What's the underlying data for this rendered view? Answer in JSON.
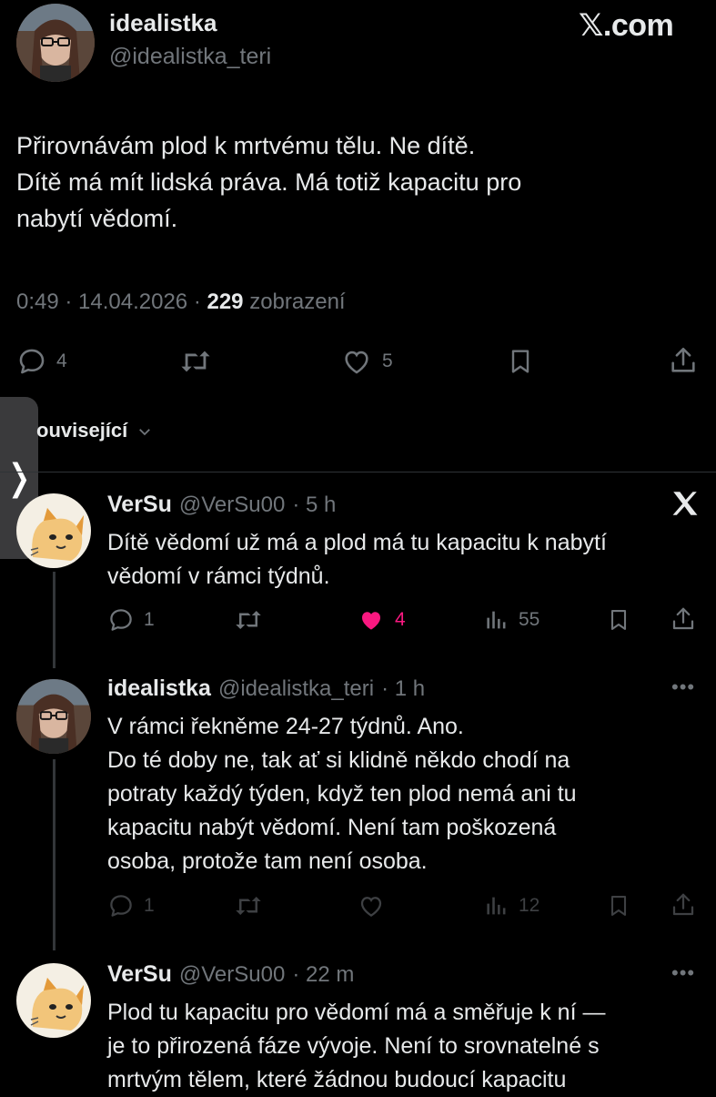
{
  "main_tweet": {
    "display_name": "idealistka",
    "handle": "@idealistka_teri",
    "brand": "𝕏.com",
    "text_lines": [
      "Přirovnávám plod k mrtvému tělu. Ne dítě.",
      "Dítě má mít lidská práva. Má totiž kapacitu pro",
      "nabytí vědomí."
    ],
    "time": "0:49 · 14.04.2026 · ",
    "views_count": "229",
    "views_label": " zobrazení",
    "reply_count": "4",
    "like_count": "5"
  },
  "related_label": "ouvisející",
  "replies": [
    {
      "display_name": "VerSu",
      "handle": "@VerSu00",
      "time": "· 5 h",
      "text_lines": [
        "Dítě vědomí už má a plod má tu kapacitu k nabytí",
        "vědomí v rámci týdnů."
      ],
      "reply_count": "1",
      "like_count": "4",
      "view_count": "55"
    },
    {
      "display_name": "idealistka",
      "handle": "@idealistka_teri",
      "time": "· 1 h",
      "text_lines": [
        "V rámci řekněme 24-27 týdnů. Ano.",
        "Do té doby ne, tak ať si klidně někdo chodí na",
        "potraty každý týden, když ten plod nemá ani tu",
        "kapacitu nabýt vědomí. Není tam poškozená",
        "osoba, protože tam není osoba."
      ],
      "reply_count": "1",
      "view_count": "12"
    },
    {
      "display_name": "VerSu",
      "handle": "@VerSu00",
      "time": "· 22 m",
      "text_lines": [
        "Plod tu kapacitu pro vědomí má a směřuje k ní —",
        "je to přirozená fáze vývoje. Není to srovnatelné s",
        "mrtvým tělem, které žádnou budoucí kapacitu"
      ]
    }
  ],
  "colors": {
    "background": "#000000",
    "text": "#e7e9ea",
    "muted": "#71767b",
    "like_active": "#f91880"
  }
}
